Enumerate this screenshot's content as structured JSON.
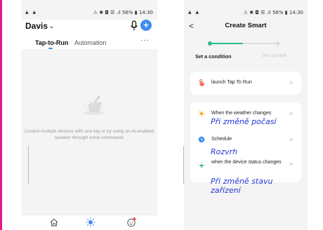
{
  "status_bar": {
    "left": "▲ ▲",
    "right": "⚠ ✱ ◘ ☰ .ıl 56% ▮ 14:30"
  },
  "screen1": {
    "home_name": "Davis",
    "home_chevron": "⌄",
    "plus_icon": "+",
    "tabs": {
      "tap_to_run": "Tap-to-Run",
      "automation": "Automation",
      "more": "···"
    },
    "empty_text": "Control multiple devices with one tap or by using an AI-enabled speaker through voice commands",
    "nav_icons": [
      "home-icon",
      "smart-icon",
      "me-icon"
    ],
    "accent": "#3d8cf0"
  },
  "screen2": {
    "back_icon": "<",
    "title": "Create Smart",
    "steps": {
      "current": "Set a condition",
      "next": "Set up task"
    },
    "conditions": [
      {
        "label": "launch Tap To Run",
        "icon": "tap-hand-icon",
        "chevron": ">"
      },
      {
        "label": "When the weather changes",
        "icon": "sun-icon",
        "chevron": ">"
      },
      {
        "label": "Schedule",
        "icon": "clock-icon",
        "chevron": ">"
      },
      {
        "label": "when the device status changes",
        "icon": "device-status-icon",
        "chevron": ">"
      }
    ],
    "annotations": {
      "weather": "Při změně počasí",
      "schedule": "Rozvrh",
      "device_line1": "Při změně stavu",
      "device_line2": "zařízení"
    },
    "accent": "#2fb98a"
  }
}
